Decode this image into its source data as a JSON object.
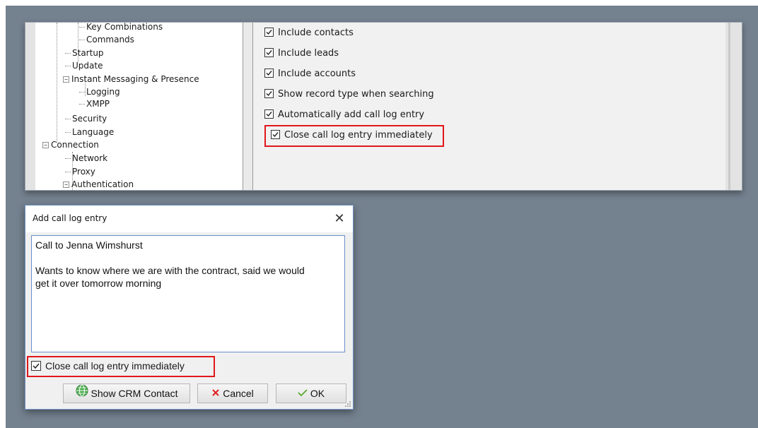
{
  "settings_tree": {
    "items": [
      {
        "label": "Key Combinations"
      },
      {
        "label": "Commands"
      },
      {
        "label": "Startup"
      },
      {
        "label": "Update"
      },
      {
        "label": "Instant Messaging & Presence",
        "expander": "−"
      },
      {
        "label": "Logging"
      },
      {
        "label": "XMPP"
      },
      {
        "label": "Security"
      },
      {
        "label": "Language"
      },
      {
        "label": "Connection",
        "expander": "−"
      },
      {
        "label": "Network"
      },
      {
        "label": "Proxy"
      },
      {
        "label": "Authentication",
        "expander": "−"
      }
    ]
  },
  "settings_options": {
    "items": [
      {
        "label": "Include contacts",
        "checked": true
      },
      {
        "label": "Include leads",
        "checked": true
      },
      {
        "label": "Include accounts",
        "checked": true
      },
      {
        "label": "Show record type when searching",
        "checked": true
      },
      {
        "label": "Automatically add call log entry",
        "checked": true
      },
      {
        "label": "Close call log entry immediately",
        "checked": true
      }
    ]
  },
  "dialog": {
    "title": "Add call log entry",
    "close_glyph": "✕",
    "text": "Call to Jenna Wimshurst\n\nWants to know where we are with the contract, said we would\nget it over tomorrow morning",
    "checkbox_label": "Close call log entry immediately",
    "checkbox_checked": true,
    "buttons": {
      "show_crm": "Show CRM Contact",
      "cancel": "Cancel",
      "ok": "OK"
    }
  },
  "colors": {
    "highlight": "#e0171b",
    "background": "#74818f",
    "cancel_icon": "#e02020",
    "ok_icon": "#5aa832",
    "crm_icon": "#4caf50"
  },
  "icons": {
    "checkbox": "check-icon",
    "cancel": "x-icon",
    "ok": "checkmark-icon",
    "crm": "globe-icon"
  }
}
